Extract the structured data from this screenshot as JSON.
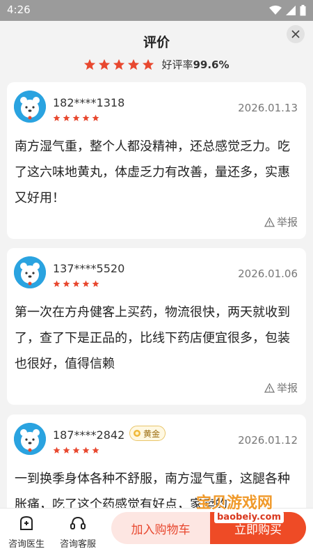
{
  "status": {
    "time": "4:26"
  },
  "header": {
    "title": "评价",
    "rating_label": "好评率",
    "rating_value": "99.6%"
  },
  "reviews": [
    {
      "user": "182****1318",
      "date": "2026.01.13",
      "stars": 5,
      "text": "南方湿气重，整个人都没精神，还总感觉乏力。吃了这六味地黄丸，体虚乏力有改善，量还多，实惠又好用！",
      "report": "举报"
    },
    {
      "user": "137****5520",
      "date": "2026.01.06",
      "stars": 5,
      "text": "第一次在方舟健客上买药，物流很快，两天就收到了，查了下是正品的，比线下药店便宜很多，包装也很好，值得信赖",
      "report": "举报"
    },
    {
      "user": "187****2842",
      "badge": "黄金",
      "date": "2026.01.12",
      "stars": 5,
      "text": "一到换季身体各种不舒服，南方湿气重，这腿各种胀痛，吃了这个药感觉有好点，家卖的"
    }
  ],
  "bottom_bar": {
    "consult_doctor": "咨询医生",
    "consult_service": "咨询客服",
    "add_to_cart": "加入购物车",
    "buy_now": "立即购买"
  },
  "watermark": {
    "main": "宝贝游戏网",
    "sub": "baobeiy.com"
  },
  "colors": {
    "accent": "#ee4b26",
    "star": "#e8482f"
  },
  "icons": [
    "wifi-icon",
    "signal-icon",
    "battery-icon",
    "close-icon",
    "star-icon",
    "avatar-icon",
    "warning-icon",
    "medal-icon",
    "doctor-icon",
    "headset-icon"
  ]
}
